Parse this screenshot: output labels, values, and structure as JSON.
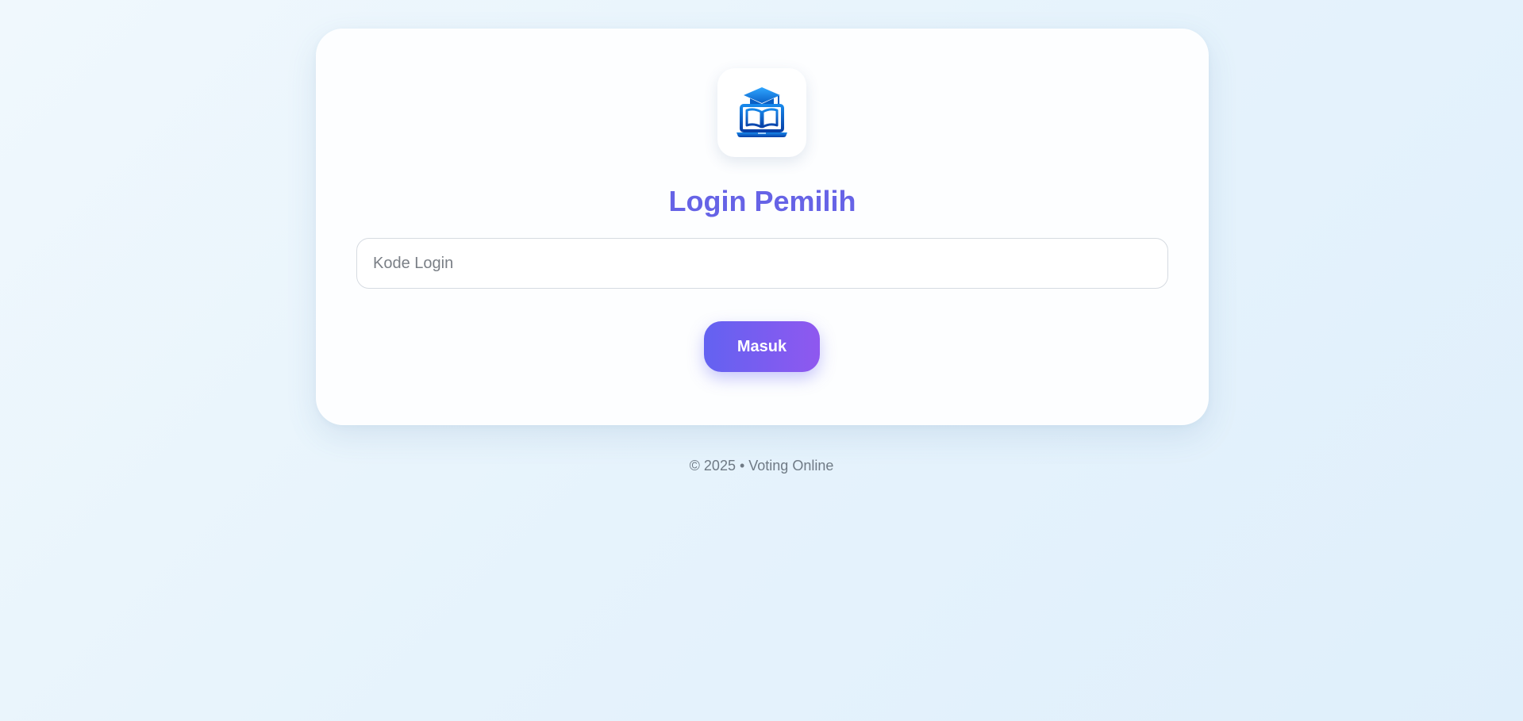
{
  "login": {
    "logo_icon": "graduation-laptop-icon",
    "title": "Login Pemilih",
    "code_placeholder": "Kode Login",
    "code_value": "",
    "submit_label": "Masuk"
  },
  "footer": {
    "text": "© 2025 • Voting Online"
  },
  "colors": {
    "title": "#6663e6",
    "button_start": "#6362f1",
    "button_end": "#8f58ef",
    "logo_blue": "#1a7fe0"
  }
}
